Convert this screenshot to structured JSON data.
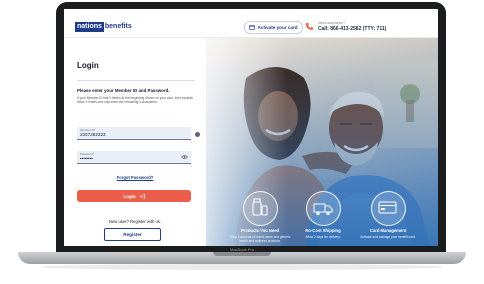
{
  "header": {
    "logo_part1": "nations",
    "logo_part2": "benefits",
    "activate_label": "Activate your card",
    "help_label": "Need assistance?",
    "help_phone": "Call: 866-413-2582 (TTY: 711)"
  },
  "login": {
    "title": "Login",
    "instruction": "Please enter your Member ID and Password.",
    "instruction_detail": "If your Member ID has 0 letters at the beginning shown on your card, then exclude those 3 letters and only enter the remaining 9 characters.",
    "member_id_label": "Member ID*",
    "member_id_value": "2347282323",
    "password_label": "Password*",
    "password_value": "••••••••",
    "forgot_label": "Forgot Password?",
    "login_button": "Login",
    "new_user_text": "New user? Register with us.",
    "register_button": "Register"
  },
  "features": [
    {
      "title": "Products You Need",
      "desc": "Shop hundreds of brand-name and generic health and wellness products."
    },
    {
      "title": "No-Cost Shipping",
      "desc": "Allow 2 days for delivery."
    },
    {
      "title": "Card Management",
      "desc": "Activate and manage your benefit card."
    }
  ],
  "device": {
    "model": "MacBook Pro"
  },
  "colors": {
    "brand_navy": "#1f3c88",
    "login_button": "#ec5e4c",
    "field_bg": "#e9eef7"
  }
}
